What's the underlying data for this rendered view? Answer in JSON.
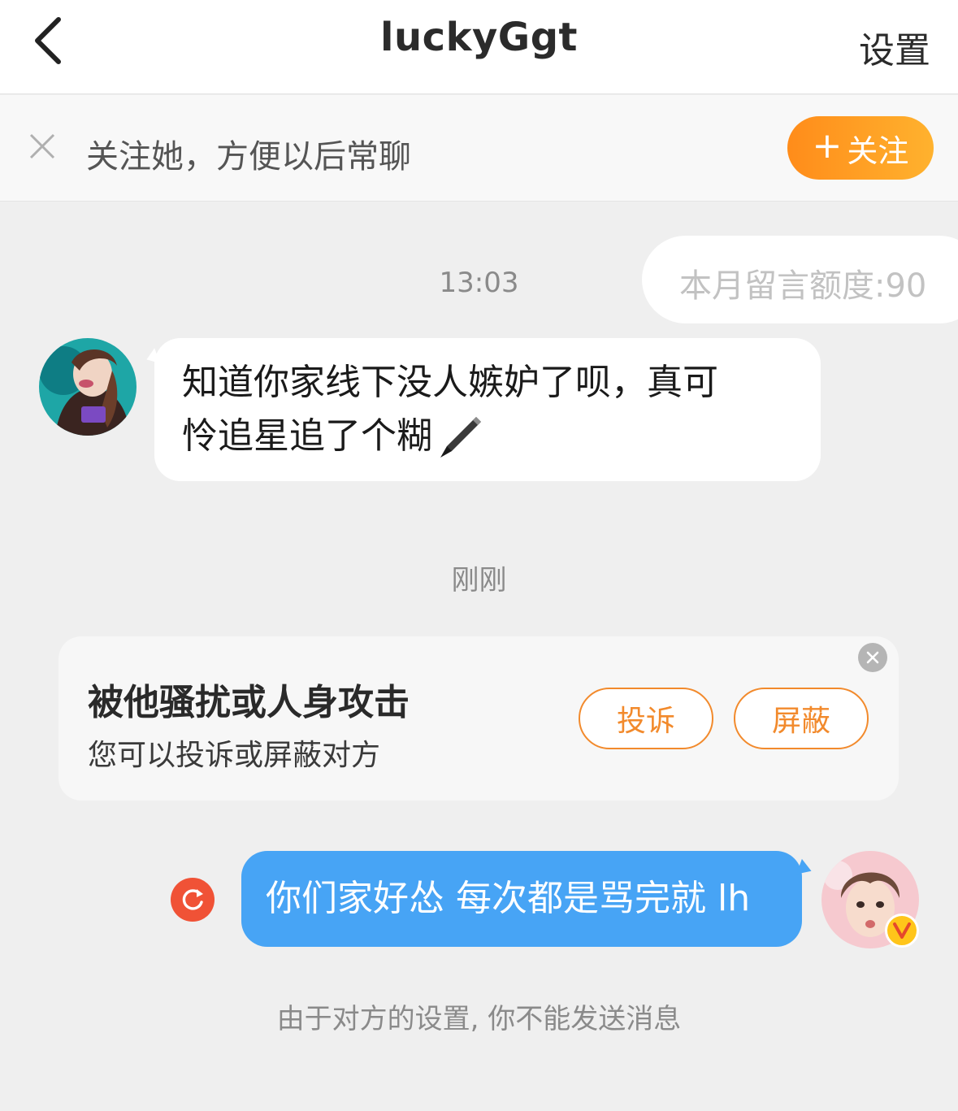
{
  "navbar": {
    "back_icon": "chevron-left-icon",
    "title": "luckyGgt",
    "settings_label": "设置"
  },
  "follow_banner": {
    "close_icon": "close-icon",
    "text": "关注她，方便以后常聊",
    "button_plus": "+",
    "button_label": "关注",
    "button_colors": [
      "#ff8c1a",
      "#ffb22e"
    ]
  },
  "quota": {
    "text": "本月留言额度:90"
  },
  "messages": {
    "time1": "13:03",
    "incoming": {
      "line1": "知道你家线下没人嫉妒了呗，真可",
      "line2": "怜追星追了个糊",
      "emoji_icon": "pen-icon"
    },
    "time2": "刚刚",
    "outgoing": {
      "text": "你们家好怂 每次都是骂完就 lh",
      "bubble_color": "#47a4f5",
      "retry_icon": "retry-icon",
      "verified_icon": "verified-v-badge-icon"
    }
  },
  "report_card": {
    "title": "被他骚扰或人身攻击",
    "subtitle": "您可以投诉或屏蔽对方",
    "complain_label": "投诉",
    "block_label": "屏蔽",
    "accent_color": "#f28a2c",
    "close_icon": "close-circle-icon"
  },
  "footer": {
    "note": "由于对方的设置, 你不能发送消息"
  }
}
